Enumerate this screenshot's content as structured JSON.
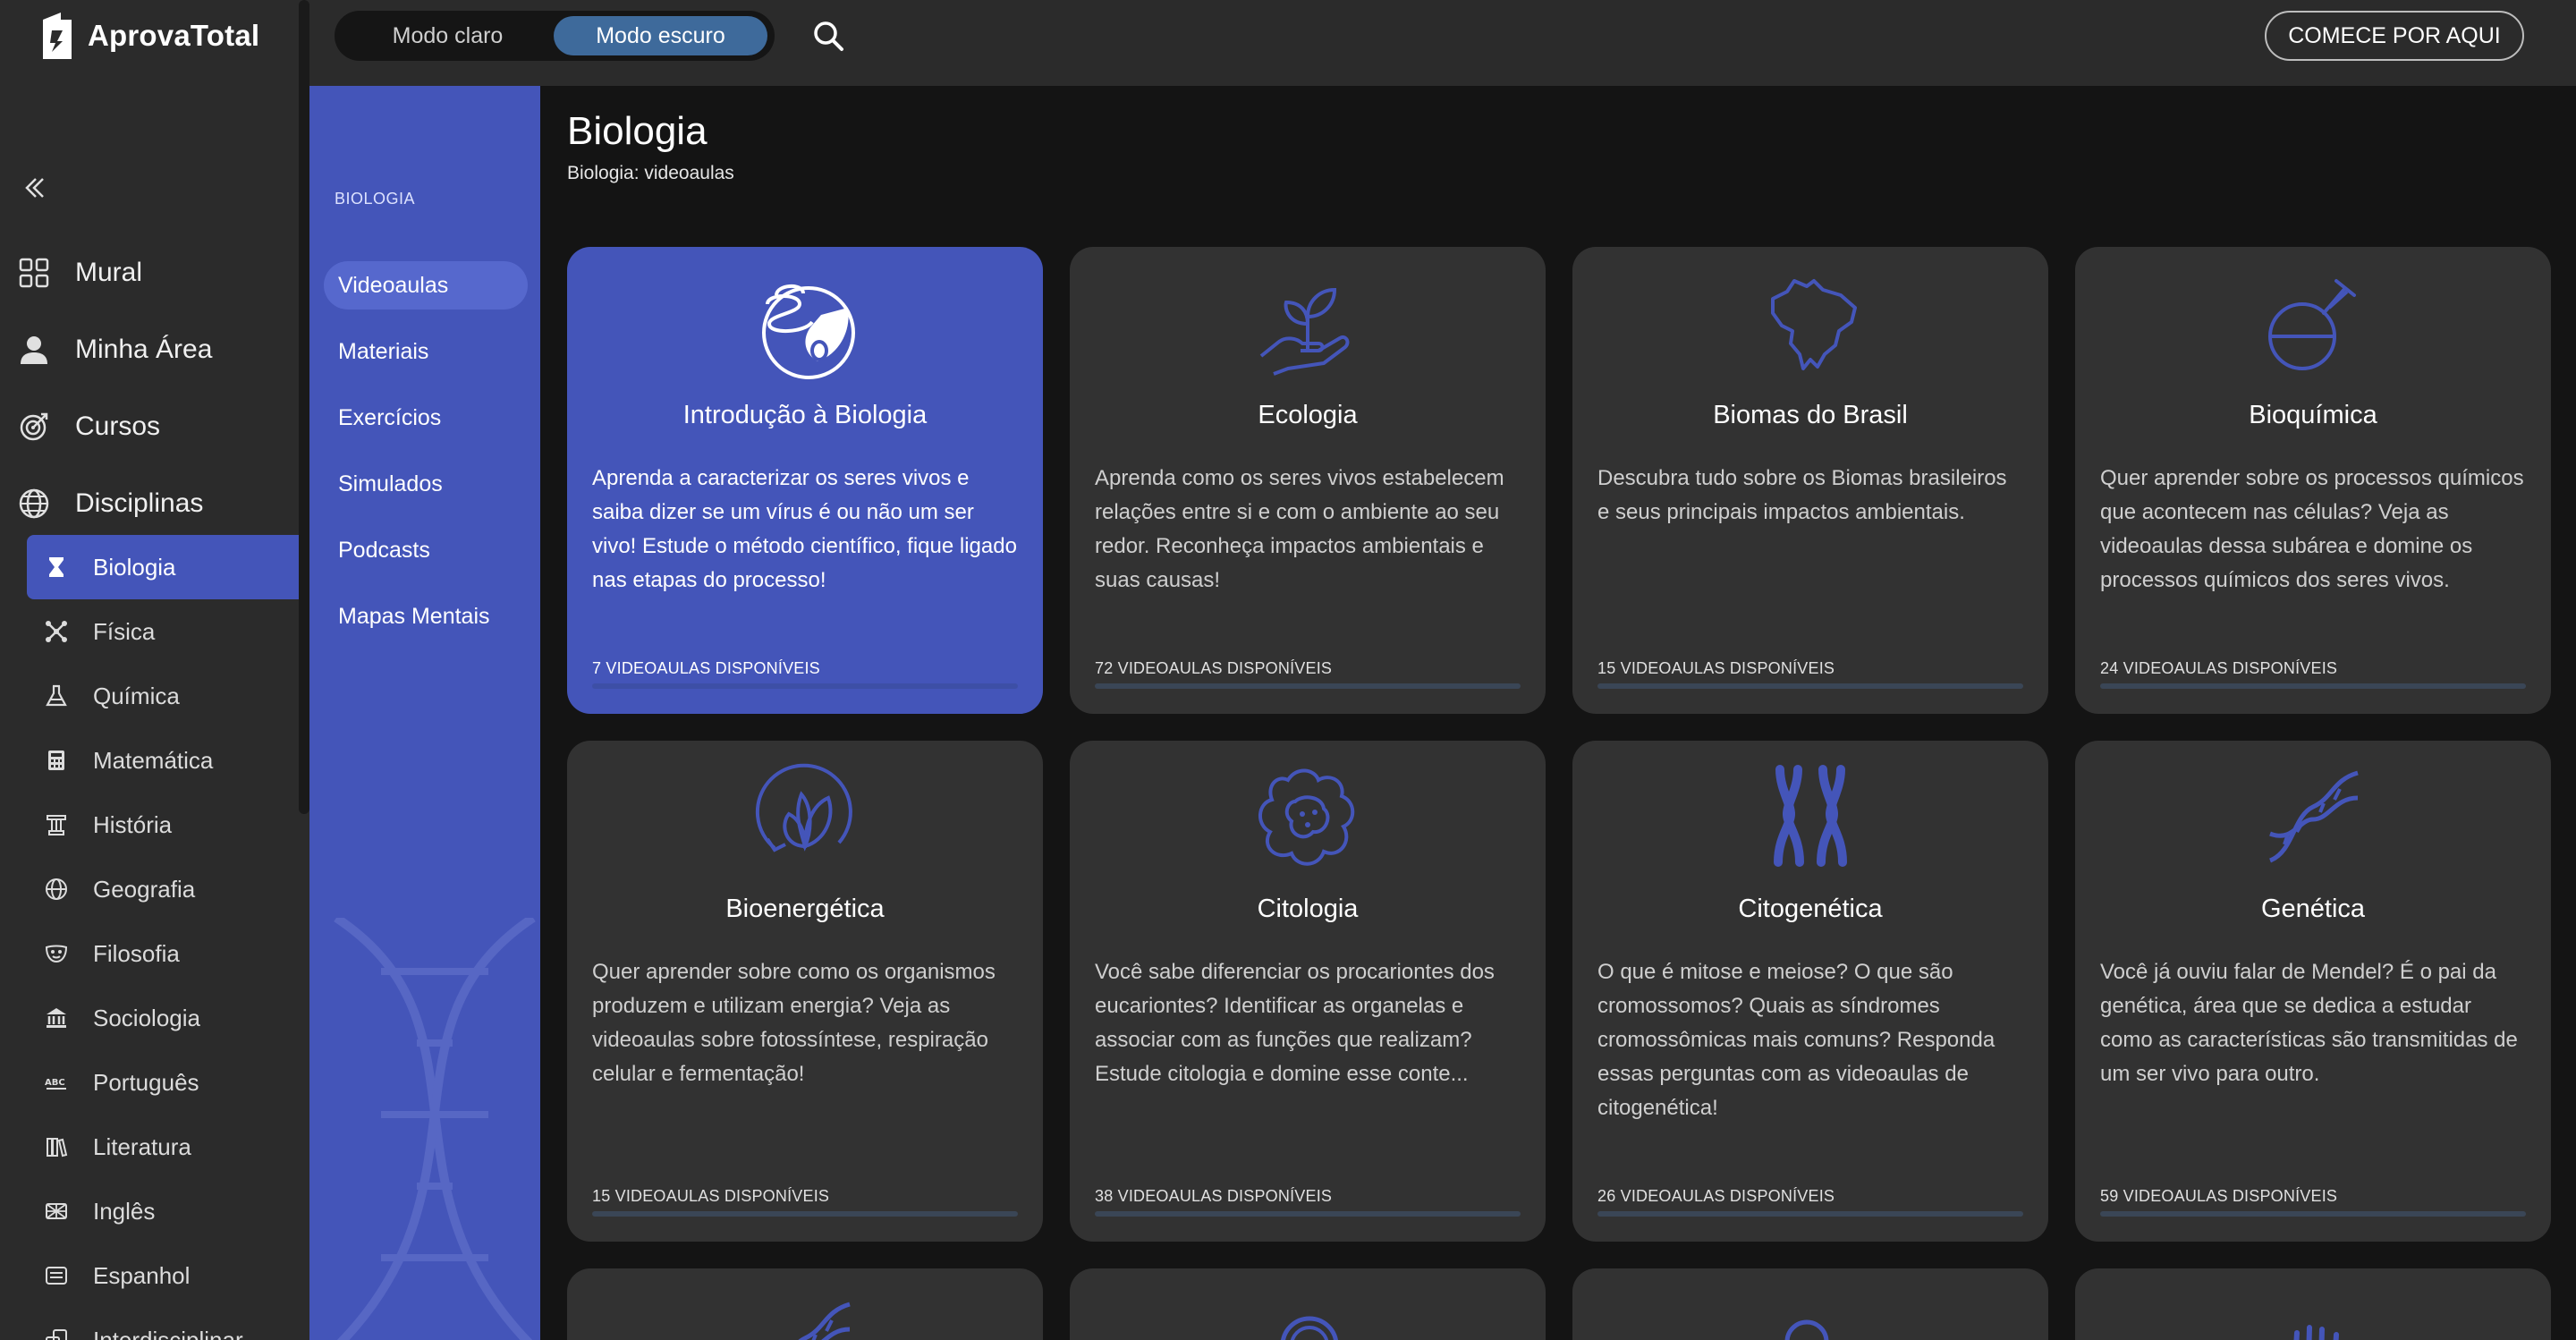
{
  "brand": {
    "name": "AprovaTotal"
  },
  "topbar": {
    "mode_light": "Modo claro",
    "mode_dark": "Modo escuro",
    "cta": "COMECE POR AQUI"
  },
  "sidebar": {
    "main": [
      {
        "label": "Mural",
        "icon": "grid-icon"
      },
      {
        "label": "Minha Área",
        "icon": "user-icon"
      },
      {
        "label": "Cursos",
        "icon": "target-icon"
      },
      {
        "label": "Disciplinas",
        "icon": "globe-icon"
      }
    ],
    "disciplines": [
      {
        "label": "Biologia",
        "icon": "hourglass-icon",
        "active": true
      },
      {
        "label": "Física",
        "icon": "atom-icon"
      },
      {
        "label": "Química",
        "icon": "flask-icon"
      },
      {
        "label": "Matemática",
        "icon": "calculator-icon"
      },
      {
        "label": "História",
        "icon": "column-icon"
      },
      {
        "label": "Geografia",
        "icon": "globe-icon"
      },
      {
        "label": "Filosofia",
        "icon": "mask-icon"
      },
      {
        "label": "Sociologia",
        "icon": "building-icon"
      },
      {
        "label": "Português",
        "icon": "abc-icon"
      },
      {
        "label": "Literatura",
        "icon": "books-icon"
      },
      {
        "label": "Inglês",
        "icon": "flag-icon"
      },
      {
        "label": "Espanhol",
        "icon": "chat-icon"
      },
      {
        "label": "Interdisciplinar",
        "icon": "layers-icon"
      }
    ]
  },
  "section": {
    "label": "BIOLOGIA",
    "links": [
      "Videoaulas",
      "Materiais",
      "Exercícios",
      "Simulados",
      "Podcasts",
      "Mapas Mentais"
    ]
  },
  "page": {
    "title": "Biologia",
    "subtitle": "Biologia: videoaulas"
  },
  "cards": [
    {
      "title": "Introdução à Biologia",
      "desc": "Aprenda a caracterizar os seres vivos e saiba dizer se um vírus é ou não um ser vivo! Estude o método científico, fique ligado nas etapas do processo!",
      "count": "7 VIDEOAULAS DISPONÍVEIS",
      "icon": "intro-biology-icon"
    },
    {
      "title": "Ecologia",
      "desc": "Aprenda como os seres vivos estabelecem relações entre si e com o ambiente ao seu redor. Reconheça impactos ambientais e suas causas!",
      "count": "72 VIDEOAULAS DISPONÍVEIS",
      "icon": "plant-hand-icon"
    },
    {
      "title": "Biomas do Brasil",
      "desc": "Descubra tudo sobre os Biomas brasileiros e seus principais impactos ambientais.",
      "count": "15 VIDEOAULAS DISPONÍVEIS",
      "icon": "brazil-map-icon"
    },
    {
      "title": "Bioquímica",
      "desc": "Quer aprender sobre os processos químicos que acontecem nas células? Veja as videoaulas dessa subárea e domine os processos químicos dos seres vivos.",
      "count": "24 VIDEOAULAS DISPONÍVEIS",
      "icon": "round-flask-icon"
    },
    {
      "title": "Bioenergética",
      "desc": "Quer aprender sobre como os organismos produzem e utilizam energia? Veja as videoaulas sobre fotossíntese, respiração celular e fermentação!",
      "count": "15 VIDEOAULAS DISPONÍVEIS",
      "icon": "leaf-cycle-icon"
    },
    {
      "title": "Citologia",
      "desc": "Você sabe diferenciar os procariontes dos eucariontes? Identificar as organelas e associar com as funções que realizam? Estude citologia e domine esse conte...",
      "count": "38 VIDEOAULAS DISPONÍVEIS",
      "icon": "cell-icon"
    },
    {
      "title": "Citogenética",
      "desc": "O que é mitose e meiose? O que são cromossomos? Quais as síndromes cromossômicas mais comuns? Responda essas perguntas com as videoaulas de citogenética!",
      "count": "26 VIDEOAULAS DISPONÍVEIS",
      "icon": "chromosome-icon"
    },
    {
      "title": "Genética",
      "desc": "Você já ouviu falar de Mendel? É o pai da genética, área que se dedica a estudar como as características são transmitidas de um ser vivo para outro.",
      "count": "59 VIDEOAULAS DISPONÍVEIS",
      "icon": "dna-icon"
    }
  ],
  "peek_cards": [
    {
      "icon": "dna-icon"
    },
    {
      "icon": "magnifier-icon"
    },
    {
      "icon": "person-icon"
    },
    {
      "icon": "grass-icon"
    }
  ],
  "colors": {
    "accent": "#4455b9",
    "card": "#323232",
    "panel": "#2b2b2b",
    "background": "#141414",
    "icon_stroke": "#4455b9"
  }
}
